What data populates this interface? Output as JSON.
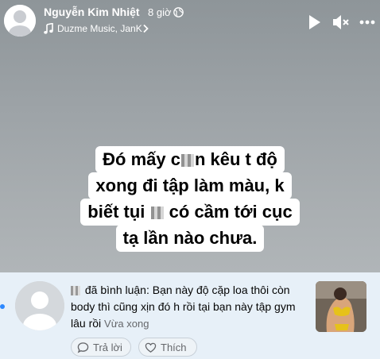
{
  "story": {
    "author_name": "Nguyễn Kim Nhiệt",
    "time": "8 giờ",
    "privacy_icon": "globe-icon",
    "music": {
      "icon": "music-note-icon",
      "label": "Duzme Music, JanK"
    },
    "controls": {
      "play_icon": "play-icon",
      "mute_icon": "muted-speaker-icon",
      "more_icon": "more-icon"
    },
    "caption": {
      "line1_a": "Đó mấy c",
      "line1_b": "n kêu t độ",
      "line2": "xong đi tập làm màu, k",
      "line3_a": "biết tụi",
      "line3_b": "có cầm tới cục",
      "line4": "tạ lần nào chưa."
    }
  },
  "notification": {
    "comment_text": "đã bình luận: Bạn này độ cặp loa thôi còn body thì cũng xịn đó h rồi tại bạn này tập gym lâu rồi",
    "time": "Vừa xong",
    "reply_label": "Trả lời",
    "like_label": "Thích",
    "colors": {
      "panel": "#e7f0f8",
      "unread_dot": "#2d88ff"
    }
  }
}
